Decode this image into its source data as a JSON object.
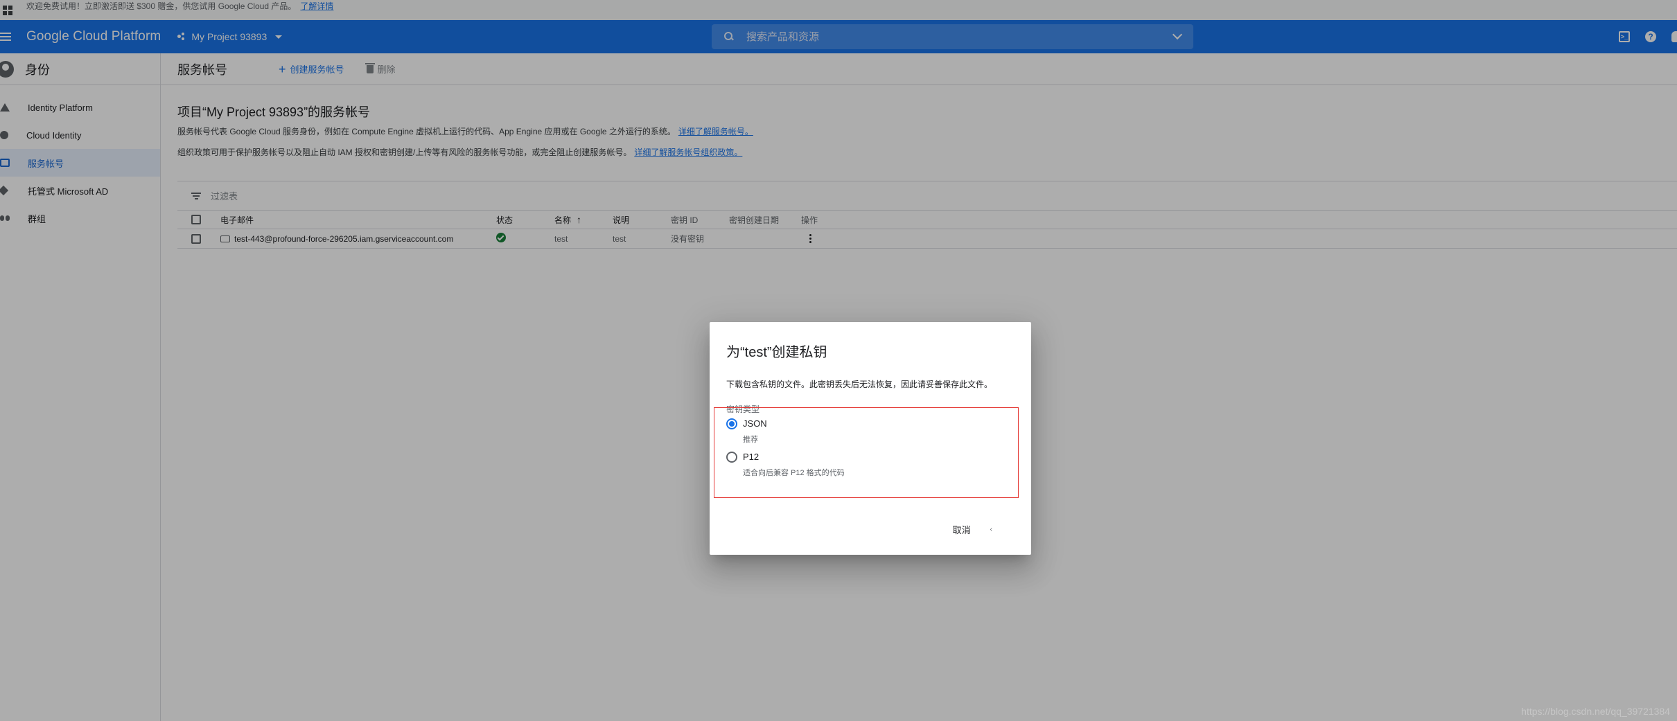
{
  "promo": {
    "text": "欢迎免费试用！立即激活即送 $300 赠金，供您试用 Google Cloud 产品。",
    "link": "了解详情"
  },
  "appbar": {
    "brand": "Google Cloud Platform",
    "project": "My Project 93893",
    "search_placeholder": "搜索产品和资源"
  },
  "sidebar": {
    "title": "身份",
    "items": [
      {
        "label": "Identity Platform",
        "icon": "identity-platform-icon"
      },
      {
        "label": "Cloud Identity",
        "icon": "cloud-identity-icon"
      },
      {
        "label": "服务帐号",
        "icon": "service-account-icon",
        "active": true
      },
      {
        "label": "托管式 Microsoft AD",
        "icon": "managed-ad-icon"
      },
      {
        "label": "群组",
        "icon": "groups-icon"
      }
    ]
  },
  "main": {
    "page_title": "服务帐号",
    "create_label": "创建服务帐号",
    "delete_label": "删除",
    "heading": "项目“My Project 93893”的服务帐号",
    "desc1": "服务帐号代表 Google Cloud 服务身份，例如在 Compute Engine 虚拟机上运行的代码、App Engine 应用或在 Google 之外运行的系统。",
    "desc1_link": "详细了解服务帐号。",
    "desc2": "组织政策可用于保护服务帐号以及阻止自动 IAM 授权和密钥创建/上传等有风险的服务帐号功能，或完全阻止创建服务帐号。",
    "desc2_link": "详细了解服务帐号组织政策。",
    "filter_placeholder": "过滤表"
  },
  "table": {
    "headers": {
      "email": "电子邮件",
      "status": "状态",
      "name": "名称",
      "desc": "说明",
      "keyid": "密钥 ID",
      "keydate": "密钥创建日期",
      "actions": "操作"
    },
    "rows": [
      {
        "email": "test-443@profound-force-296205.iam.gserviceaccount.com",
        "status": "enabled",
        "name": "test",
        "desc": "test",
        "keyid": "没有密钥",
        "keydate": ""
      }
    ]
  },
  "dialog": {
    "title": "为“test”创建私钥",
    "desc": "下载包含私钥的文件。此密钥丢失后无法恢复，因此请妥善保存此文件。",
    "key_type_label": "密钥类型",
    "options": [
      {
        "label": "JSON",
        "sub": "推荐",
        "checked": true
      },
      {
        "label": "P12",
        "sub": "适合向后兼容 P12 格式的代码",
        "checked": false
      }
    ],
    "cancel": "取消",
    "create": "‹"
  },
  "watermark": "https://blog.csdn.net/qq_39721384",
  "colors": {
    "brand_blue": "#1a73e8",
    "highlight_red": "#e53935",
    "success_green": "#188038"
  }
}
